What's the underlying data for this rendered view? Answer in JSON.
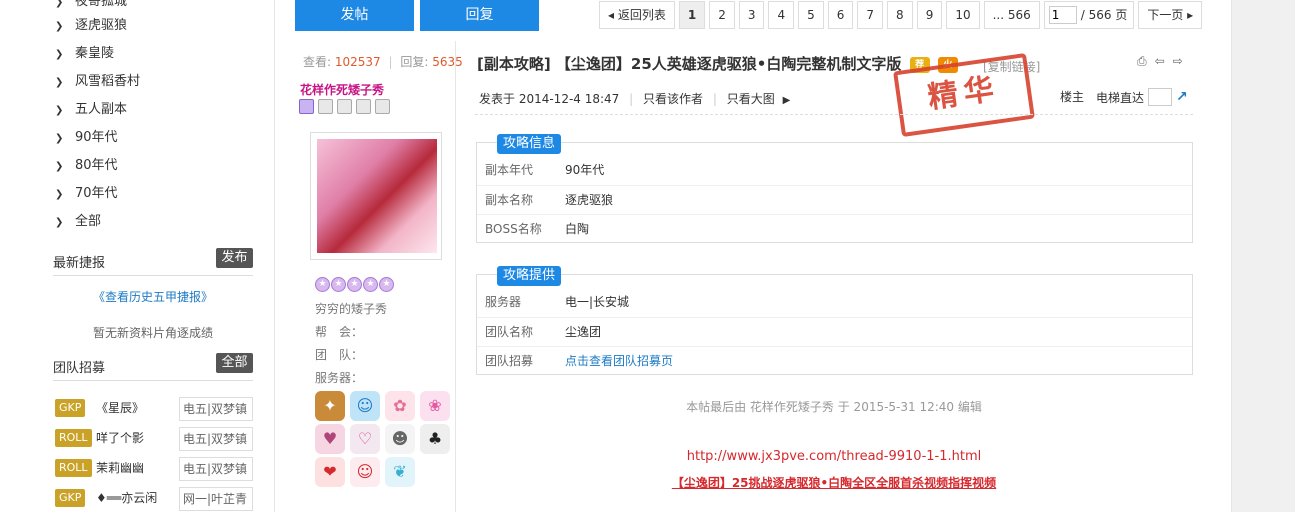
{
  "nav": {
    "items": [
      {
        "label": "夜寄孤城"
      },
      {
        "label": "逐虎驱狼"
      },
      {
        "label": "秦皇陵"
      },
      {
        "label": "风雪稻香村"
      },
      {
        "label": "五人副本"
      },
      {
        "label": "90年代"
      },
      {
        "label": "80年代"
      },
      {
        "label": "70年代"
      },
      {
        "label": "全部"
      }
    ]
  },
  "news": {
    "title": "最新捷报",
    "button": "发布",
    "history_link": "《查看历史五甲捷报》",
    "empty_text": "暂无新资料片角逐成绩"
  },
  "teams": {
    "title": "团队招募",
    "button": "全部",
    "rows": [
      {
        "tag": "GKP",
        "name": "《星辰》",
        "server": "电五|双梦镇"
      },
      {
        "tag": "ROLL",
        "name": "咩了个影",
        "server": "电五|双梦镇"
      },
      {
        "tag": "ROLL",
        "name": "茉莉幽幽",
        "server": "电五|双梦镇"
      },
      {
        "tag": "GKP",
        "name": "♦══亦云闲",
        "server": "网一|叶芷青"
      }
    ]
  },
  "toolbar": {
    "post_button": "发帖",
    "reply_button": "回复"
  },
  "pager": {
    "back": "◂ 返回列表",
    "pages": [
      "1",
      "2",
      "3",
      "4",
      "5",
      "6",
      "7",
      "8",
      "9",
      "10"
    ],
    "current": "1",
    "last": "... 566",
    "input_value": "1",
    "total": "/ 566 页",
    "next": "下一页 ▸"
  },
  "author": {
    "views_label": "查看:",
    "views": "102537",
    "replies_label": "回复:",
    "replies": "5635",
    "name": "花样作死矮子秀",
    "title": "穷穷的矮子秀",
    "guild_label": "帮　会：",
    "team_label": "团　队：",
    "server_label": "服务器："
  },
  "post": {
    "title": "[副本攻略] 【尘逸团】25人英雄逐虎驱狼•白陶完整机制文字版",
    "badge_recommend": "荐",
    "badge_hot": "火",
    "copy_link": "[复制链接]",
    "posted_at": "发表于 2014-12-4 18:47",
    "only_author": "只看该作者",
    "only_images": "只看大图",
    "floor": "楼主",
    "elevator": "电梯直达",
    "stamp": "精华"
  },
  "strategy_info": {
    "tag": "攻略信息",
    "rows": [
      {
        "key": "副本年代",
        "value": "90年代"
      },
      {
        "key": "副本名称",
        "value": "逐虎驱狼"
      },
      {
        "key": "BOSS名称",
        "value": "白陶"
      }
    ]
  },
  "strategy_provider": {
    "tag": "攻略提供",
    "rows": [
      {
        "key": "服务器",
        "value": "电一|长安城"
      },
      {
        "key": "团队名称",
        "value": "尘逸团"
      },
      {
        "key": "团队招募",
        "value": "点击查看团队招募页"
      }
    ]
  },
  "footer": {
    "edited": "本帖最后由 花样作死矮子秀 于 2015-5-31 12:40 编辑",
    "url": "http://www.jx3pve.com/thread-9910-1-1.html",
    "video_link": "【尘逸团】25挑战逐虎驱狼•白陶全区全服首杀视频指挥视频"
  },
  "colors": {
    "accent": "#1e88e5",
    "hot": "#d6282d",
    "gold_tag": "#c9a227"
  }
}
